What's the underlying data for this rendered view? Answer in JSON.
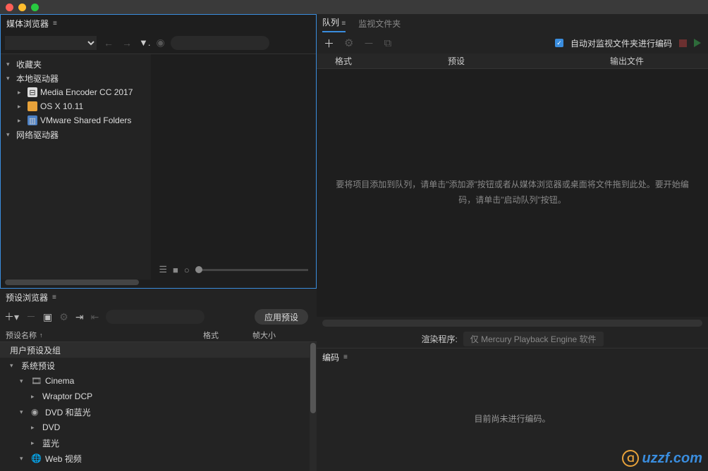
{
  "panels": {
    "media_browser": {
      "title": "媒体浏览器"
    },
    "preset_browser": {
      "title": "预设浏览器"
    },
    "encode": {
      "title": "编码"
    }
  },
  "tabs": {
    "queue": "队列",
    "watch": "监视文件夹"
  },
  "media_tree": {
    "favorites": "收藏夹",
    "local_drives": "本地驱动器",
    "drives": [
      {
        "label": "Media Encoder CC 2017"
      },
      {
        "label": "OS X 10.11"
      },
      {
        "label": "VMware Shared Folders"
      }
    ],
    "network_drives": "网络驱动器"
  },
  "preset_toolbar": {
    "search_placeholder": "",
    "apply_label": "应用预设"
  },
  "preset_header": {
    "name": "预设名称",
    "format": "格式",
    "size": "帧大小"
  },
  "preset_rows": [
    {
      "label": "用户预设及组",
      "type": "group"
    },
    {
      "label": "系统预设",
      "type": "section"
    },
    {
      "label": "Cinema",
      "type": "category",
      "icon": "film"
    },
    {
      "label": "Wraptor DCP",
      "type": "item"
    },
    {
      "label": "DVD 和蓝光",
      "type": "category",
      "icon": "disc"
    },
    {
      "label": "DVD",
      "type": "item"
    },
    {
      "label": "蓝光",
      "type": "item"
    },
    {
      "label": "Web 视频",
      "type": "category",
      "icon": "globe"
    }
  ],
  "queue": {
    "auto_encode_label": "自动对监视文件夹进行编码",
    "cols": {
      "format": "格式",
      "preset": "预设",
      "output": "输出文件"
    },
    "empty_text": "要将项目添加到队列，请单击\"添加源\"按钮或者从媒体浏览器或桌面将文件拖到此处。要开始编码，请单击\"启动队列\"按钮。",
    "renderer_label": "渲染程序:",
    "renderer_value": "仅 Mercury Playback Engine 软件"
  },
  "encode": {
    "idle_text": "目前尚未进行编码。"
  },
  "watermark": "uzzf.com"
}
